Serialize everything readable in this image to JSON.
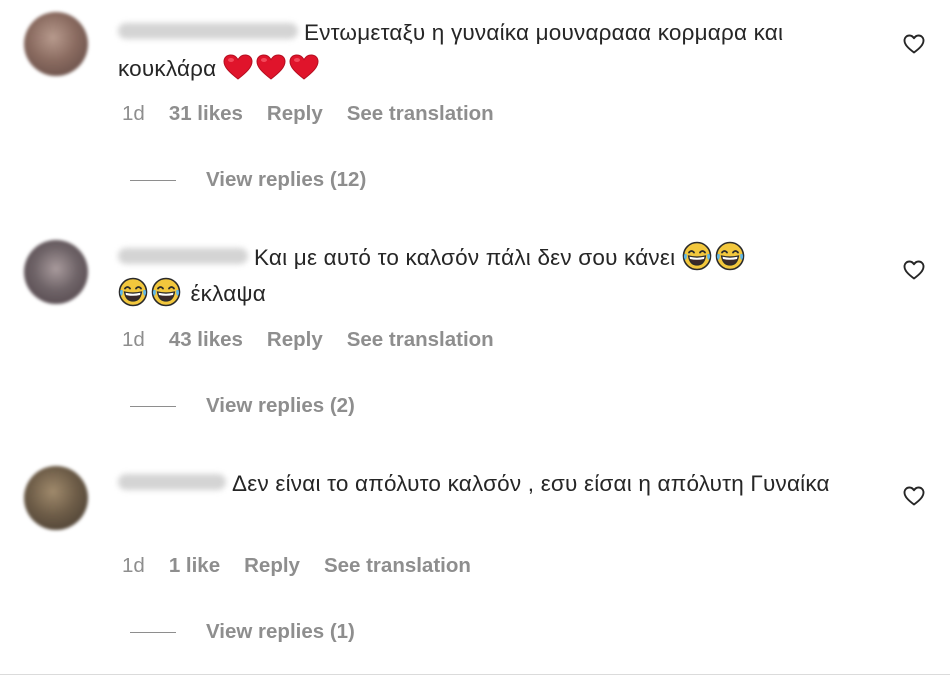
{
  "comments": [
    {
      "text": "Εντωμεταξυ η γυναίκα μουναρααα κορμαρα και κουκλάρα",
      "emojis": [
        "red-heart",
        "red-heart",
        "red-heart"
      ],
      "time": "1d",
      "likes": "31 likes",
      "reply_label": "Reply",
      "translate_label": "See translation",
      "replies_label": "View replies (12)"
    },
    {
      "text_1": "Και με αυτό το καλσόν πάλι δεν σου κάνει",
      "text_2": "έκλαψα",
      "emojis": [
        "tears-of-joy",
        "tears-of-joy",
        "tears-of-joy",
        "tears-of-joy"
      ],
      "time": "1d",
      "likes": "43 likes",
      "reply_label": "Reply",
      "translate_label": "See translation",
      "replies_label": "View replies (2)"
    },
    {
      "text": "Δεν είναι το απόλυτο καλσόν , εσυ είσαι η απόλυτη Γυναίκα",
      "time": "1d",
      "likes": "1 like",
      "reply_label": "Reply",
      "translate_label": "See translation",
      "replies_label": "View replies (1)"
    }
  ],
  "colors": {
    "text": "#262626",
    "secondary": "#8e8e8e",
    "heart": "#e0142b",
    "emoji_yellow": "#f2c73d"
  },
  "icons": {
    "like": "heart-outline-icon",
    "avatar": "blurred-avatar"
  }
}
